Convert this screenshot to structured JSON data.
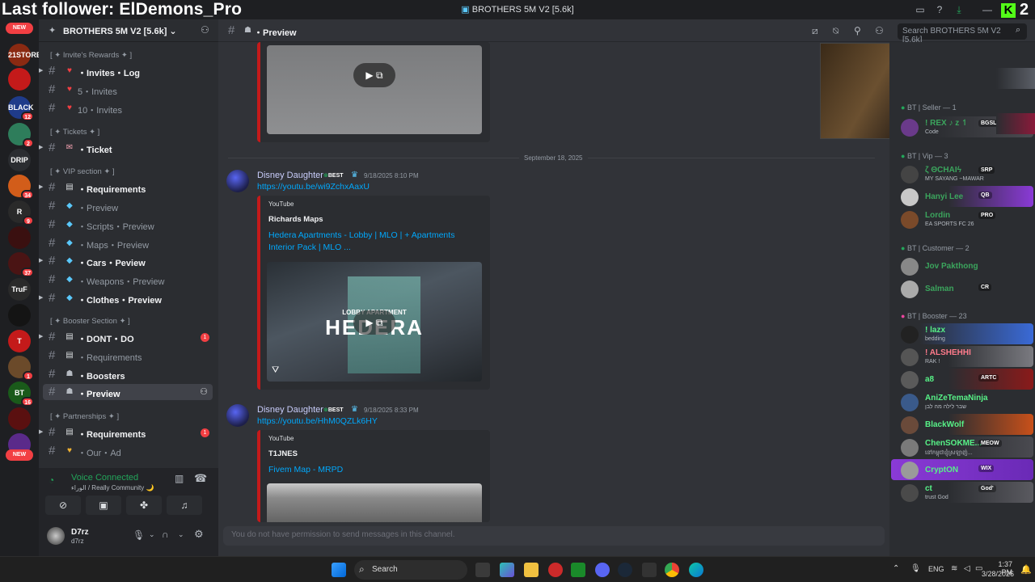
{
  "overlay": {
    "text": "Last follower: ElDemons_Pro",
    "k_count": "2"
  },
  "window": {
    "title": "BROTHERS 5M V2 [5.6k]"
  },
  "rail": {
    "new_label": "NEW",
    "servers": [
      {
        "name": "21STORE",
        "color": "#8a2a12",
        "badge": ""
      },
      {
        "name": "",
        "color": "#c41a1a",
        "badge": ""
      },
      {
        "name": "BLACK",
        "color": "#1f3b8a",
        "badge": "12"
      },
      {
        "name": "",
        "color": "#2e7d5b",
        "badge": "2"
      },
      {
        "name": "DRIP",
        "color": "#2b2d31",
        "badge": ""
      },
      {
        "name": "",
        "color": "#d25d1a",
        "badge": "34"
      },
      {
        "name": "R",
        "color": "#2a2a2a",
        "badge": "9"
      },
      {
        "name": "",
        "color": "#3a1010",
        "badge": ""
      },
      {
        "name": "",
        "color": "#4a1414",
        "badge": "37"
      },
      {
        "name": "TruF",
        "color": "#2a2a2a",
        "badge": ""
      },
      {
        "name": "",
        "color": "#141414",
        "badge": ""
      },
      {
        "name": "T",
        "color": "#c41a1a",
        "badge": ""
      },
      {
        "name": "",
        "color": "#6b4a2a",
        "badge": "1"
      },
      {
        "name": "BT",
        "color": "#1a5a1a",
        "badge": "16"
      },
      {
        "name": "",
        "color": "#5a1010",
        "badge": ""
      },
      {
        "name": "",
        "color": "#5a2a8a",
        "badge": ""
      }
    ]
  },
  "sidebar": {
    "server_name": "BROTHERS 5M V2 [5.6k]",
    "categories": [
      {
        "label": "[ ✦ Invite's Rewards ✦ ]"
      },
      {
        "label": "[ ✦ Tickets ✦ ]"
      },
      {
        "label": "[ ✦ VIP section ✦ ]"
      },
      {
        "label": "[ ✦ Booster Section ✦ ]"
      },
      {
        "label": "[ ✦ Partnerships ✦ ]"
      }
    ],
    "channels": [
      {
        "label": "・Invites・Log",
        "icon": "♥",
        "icon_color": "#f23f43"
      },
      {
        "label": "5・Invites",
        "icon": "♥",
        "icon_color": "#f23f43"
      },
      {
        "label": "10・Invites",
        "icon": "♥",
        "icon_color": "#f23f43"
      },
      {
        "label": "・Ticket",
        "icon": "✉",
        "icon_color": "#f0a0b0"
      },
      {
        "label": "・Requirements",
        "icon": "▤",
        "icon_color": "#dbdee1"
      },
      {
        "label": "・Preview",
        "icon": "◆",
        "icon_color": "#5ac8fa"
      },
      {
        "label": "・Scripts・Preview",
        "icon": "◆",
        "icon_color": "#5ac8fa"
      },
      {
        "label": "・Maps・Preview",
        "icon": "◆",
        "icon_color": "#5ac8fa"
      },
      {
        "label": "・Cars・Peview",
        "icon": "◆",
        "icon_color": "#5ac8fa"
      },
      {
        "label": "・Weapons・Preview",
        "icon": "◆",
        "icon_color": "#5ac8fa"
      },
      {
        "label": "・Clothes・Preview",
        "icon": "◆",
        "icon_color": "#5ac8fa"
      },
      {
        "label": "・DONT・DO",
        "icon": "▤",
        "icon_color": "#dbdee1",
        "mention": "1"
      },
      {
        "label": "・Requirements",
        "icon": "▤",
        "icon_color": "#dbdee1"
      },
      {
        "label": "・Boosters",
        "icon": "☗",
        "icon_color": "#b5bac1"
      },
      {
        "label": "・Preview",
        "icon": "☗",
        "icon_color": "#b5bac1"
      },
      {
        "label": "・Requirements",
        "icon": "▤",
        "icon_color": "#dbdee1",
        "mention": "1"
      },
      {
        "label": "・Our・Ad",
        "icon": "♥",
        "icon_color": "#f0b232"
      }
    ],
    "voice": {
      "status": "Voice Connected",
      "channel": "الوراء / Really Community 🌙"
    },
    "user": {
      "name": "D7rz",
      "tag": "d7rz"
    }
  },
  "chat": {
    "channel": "・Preview",
    "search_placeholder": "Search BROTHERS 5M V2 [5.6k]",
    "date_divider": "September 18, 2025",
    "messages": [
      {
        "author": "Disney Daughter",
        "badge": "BEST",
        "time": "9/18/2025 8:10 PM",
        "link": "https://youtu.be/wi9ZchxAaxU",
        "embed_provider": "YouTube",
        "embed_author": "Richards Maps",
        "embed_title": "Hedera Apartments - Lobby | MLO | + Apartments Interior Pack | MLO ...",
        "thumb_text": "HEDERA",
        "thumb_sub": "LOBBY APARTMENT"
      },
      {
        "author": "Disney Daughter",
        "badge": "BEST",
        "time": "9/18/2025 8:33 PM",
        "link": "https://youtu.be/HhM0QZLk6HY",
        "embed_provider": "YouTube",
        "embed_author": "T1JNES",
        "embed_title": "Fivem Map - MRPD"
      }
    ],
    "no_permission": "You do not have permission to send messages in this channel."
  },
  "members": {
    "groups": [
      {
        "label": "BT | Seller — 1",
        "color": "#23a55a",
        "members": [
          {
            "name": "! REX ♪ z ↿",
            "status": "Code",
            "color": "#3ba55d",
            "tag": "BGSL"
          }
        ]
      },
      {
        "label": "BT | Vip — 3",
        "color": "#23a55a",
        "members": [
          {
            "name": "ζ ΘCHAIϟ",
            "status": "MY SAYANG ~MAWAR",
            "color": "#3ba55d",
            "tag": "SRP"
          },
          {
            "name": "Hanyi Lee",
            "status": "",
            "color": "#3ba55d",
            "tag": "QB"
          },
          {
            "name": "Lordin",
            "status": "EA SPORTS FC 26",
            "color": "#3ba55d",
            "tag": "PRO"
          }
        ]
      },
      {
        "label": "BT | Customer — 2",
        "color": "#23a55a",
        "members": [
          {
            "name": "Jov Pakthong",
            "status": "",
            "color": "#3ba55d",
            "tag": ""
          },
          {
            "name": "Salman",
            "status": "",
            "color": "#3ba55d",
            "tag": "CR"
          }
        ]
      },
      {
        "label": "BT | Booster — 23",
        "color": "#eb459e",
        "members": [
          {
            "name": "! lazx",
            "status": "bedding",
            "color": "#57f287",
            "tag": ""
          },
          {
            "name": "! ALSHEHHI",
            "status": "RAK !",
            "color": "#ff7b8b",
            "tag": ""
          },
          {
            "name": "a8",
            "status": "",
            "color": "#57f287",
            "tag": "ARTC"
          },
          {
            "name": "AniZeTemaNinja",
            "status": "שבר לילה מה לבן",
            "color": "#57f287",
            "tag": ""
          },
          {
            "name": "BlackWolf",
            "status": "",
            "color": "#57f287",
            "tag": ""
          },
          {
            "name": "ChenSOKME...",
            "status": "នៅកម្ពុជាខ្ញុំស្រឡាញ់...",
            "color": "#57f287",
            "tag": "MEOW"
          },
          {
            "name": "CryptON",
            "status": "",
            "color": "#57f287",
            "tag": "WIX"
          },
          {
            "name": "ct",
            "status": "trust God",
            "color": "#57f287",
            "tag": "God'"
          }
        ]
      }
    ]
  },
  "taskbar": {
    "search": "Search",
    "lang": "ENG",
    "time": "1:37 PM",
    "date": "3/28/2026"
  }
}
